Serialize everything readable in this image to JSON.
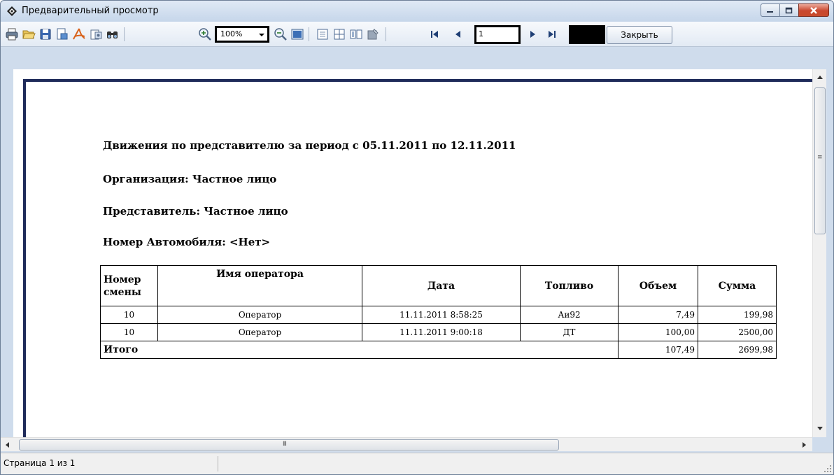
{
  "window": {
    "title": "Предварительный просмотр"
  },
  "toolbar": {
    "zoom_value": "100%",
    "page_value": "1",
    "close_label": "Закрыть",
    "icons": [
      "print-icon",
      "open-icon",
      "save-icon",
      "export-icon",
      "pdf-icon",
      "mail-icon",
      "find-icon",
      "zoom-in-icon",
      "zoom-out-icon",
      "page-view-icon",
      "one-page-icon",
      "multi-page-icon",
      "outline-icon",
      "edit-icon",
      "first-page-icon",
      "prev-page-icon",
      "next-page-icon",
      "last-page-icon"
    ]
  },
  "report": {
    "title": "Движения по представителю за период с 05.11.2011 по 12.11.2011",
    "organization": "Организация: Частное лицо",
    "representative": "Представитель: Частное лицо",
    "car_number": "Номер Автомобиля: <Нет>",
    "table": {
      "headers": {
        "shift": "Номер смены",
        "operator": "Имя оператора",
        "date": "Дата",
        "fuel": "Топливо",
        "volume": "Объем",
        "amount": "Сумма"
      },
      "rows": [
        {
          "shift": "10",
          "operator": "Оператор",
          "date": "11.11.2011 8:58:25",
          "fuel": "Аи92",
          "volume": "7,49",
          "amount": "199,98"
        },
        {
          "shift": "10",
          "operator": "Оператор",
          "date": "11.11.2011 9:00:18",
          "fuel": "ДТ",
          "volume": "100,00",
          "amount": "2500,00"
        }
      ],
      "total": {
        "label": "Итого",
        "volume": "107,49",
        "amount": "2699,98"
      }
    }
  },
  "scrollbar": {
    "h_grip": "III",
    "v_grip": "≡"
  },
  "status": {
    "page_text": "Страница 1 из 1"
  }
}
